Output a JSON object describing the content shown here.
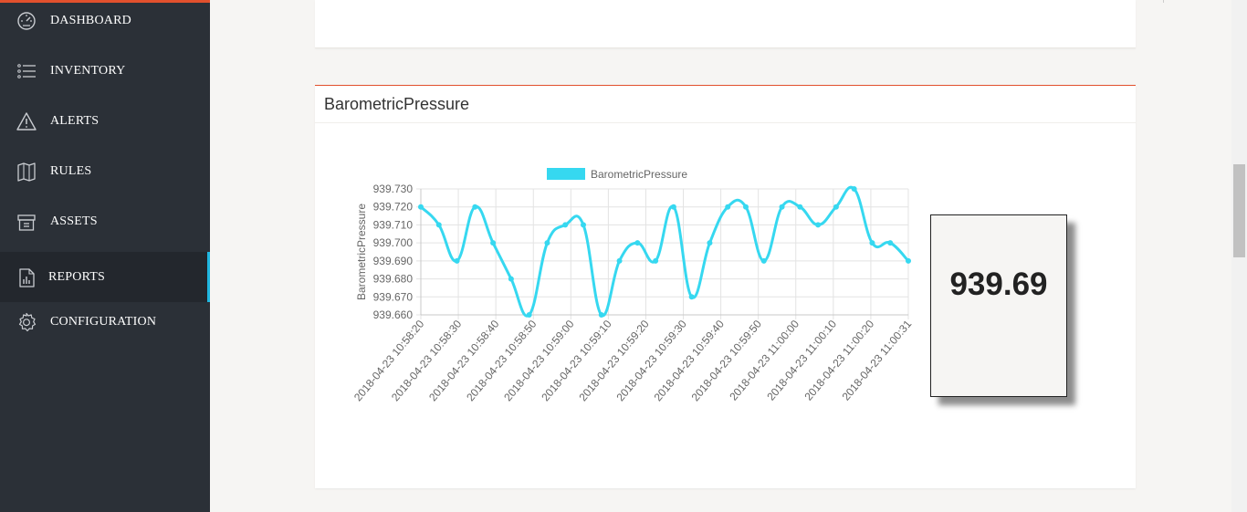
{
  "sidebar": {
    "items": [
      {
        "label": "DASHBOARD",
        "icon": "dashboard-gauge-icon",
        "active": false
      },
      {
        "label": "INVENTORY",
        "icon": "list-icon",
        "active": false
      },
      {
        "label": "ALERTS",
        "icon": "warning-triangle-icon",
        "active": false
      },
      {
        "label": "RULES",
        "icon": "book-icon",
        "active": false
      },
      {
        "label": "ASSETS",
        "icon": "box-icon",
        "active": false
      },
      {
        "label": "REPORTS",
        "icon": "report-chart-icon",
        "active": true
      },
      {
        "label": "CONFIGURATION",
        "icon": "gear-icon",
        "active": false
      }
    ]
  },
  "card": {
    "title": "BarometricPressure",
    "current_value": "939.69"
  },
  "colors": {
    "accent": "#e2502d",
    "series": "#36d8f0",
    "sidebar_bg": "#2b3037",
    "active_indicator": "#1fb6e0"
  },
  "chart_data": {
    "type": "line",
    "title": "",
    "legend": "BarometricPressure",
    "legend_placement": "top",
    "ylabel": "BarometricPressure",
    "xlabel": "",
    "ylim": [
      939.66,
      939.73
    ],
    "yticks": [
      "939.730",
      "939.720",
      "939.710",
      "939.700",
      "939.690",
      "939.680",
      "939.670",
      "939.660"
    ],
    "xtick_labels": [
      "2018-04-23 10:58:20",
      "2018-04-23 10:58:30",
      "2018-04-23 10:58:40",
      "2018-04-23 10:58:50",
      "2018-04-23 10:59:00",
      "2018-04-23 10:59:10",
      "2018-04-23 10:59:20",
      "2018-04-23 10:59:30",
      "2018-04-23 10:59:40",
      "2018-04-23 10:59:50",
      "2018-04-23 11:00:00",
      "2018-04-23 11:00:10",
      "2018-04-23 11:00:20",
      "2018-04-23 11:00:31"
    ],
    "grid": true,
    "series": [
      {
        "name": "BarometricPressure",
        "values": [
          939.72,
          939.71,
          939.69,
          939.72,
          939.7,
          939.68,
          939.66,
          939.7,
          939.71,
          939.71,
          939.66,
          939.69,
          939.7,
          939.69,
          939.72,
          939.67,
          939.7,
          939.72,
          939.72,
          939.69,
          939.72,
          939.72,
          939.71,
          939.72,
          939.73,
          939.7,
          939.7,
          939.69
        ]
      }
    ]
  }
}
